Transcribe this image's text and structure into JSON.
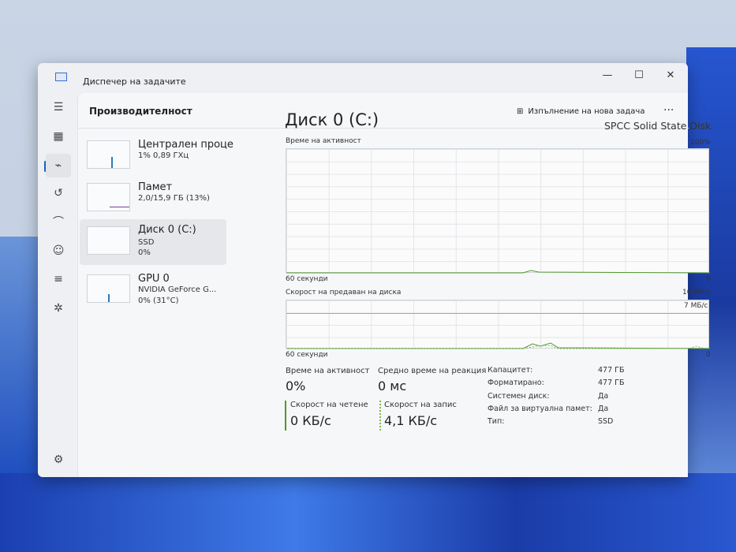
{
  "window": {
    "title": "Диспечер на задачите",
    "minimize": "—",
    "maximize": "☐",
    "close": "✕"
  },
  "header": {
    "title": "Производителност",
    "run_task": "Изпълнение на нова задача",
    "more": "···"
  },
  "devices": [
    {
      "name": "Централен проце",
      "sub1": "1% 0,89 ГХц",
      "sub2": ""
    },
    {
      "name": "Памет",
      "sub1": "2,0/15,9 ГБ (13%)",
      "sub2": ""
    },
    {
      "name": "Диск 0 (C:)",
      "sub1": "SSD",
      "sub2": "0%"
    },
    {
      "name": "GPU 0",
      "sub1": "NVIDIA GeForce G...",
      "sub2": "0% (31°C)"
    }
  ],
  "disk": {
    "title": "Диск 0 (C:)",
    "model": "SPCC Solid State Disk",
    "activity_chart": {
      "label": "Време на активност",
      "max": "100%",
      "xlabel": "60 секунди",
      "min": "0"
    },
    "transfer_chart": {
      "label": "Скорост на предаван на диска",
      "max": "10 МБ/с",
      "line": "7 МБ/с",
      "xlabel": "60 секунди",
      "min": "0"
    },
    "stats": {
      "active_label": "Време на активност",
      "active": "0%",
      "resp_label": "Средно време на реакция",
      "resp": "0 мс",
      "read_label": "Скорост на четене",
      "read": "0 КБ/с",
      "write_label": "Скорост на запис",
      "write": "4,1 КБ/с"
    },
    "props": [
      {
        "k": "Капацитет:",
        "v": "477 ГБ"
      },
      {
        "k": "Форматирано:",
        "v": "477 ГБ"
      },
      {
        "k": "Системен диск:",
        "v": "Да"
      },
      {
        "k": "Файл за виртуална памет:",
        "v": "Да"
      },
      {
        "k": "Тип:",
        "v": "SSD"
      }
    ]
  },
  "colors": {
    "accent": "#1f5fbf",
    "disk_green": "#4f9a2a"
  }
}
